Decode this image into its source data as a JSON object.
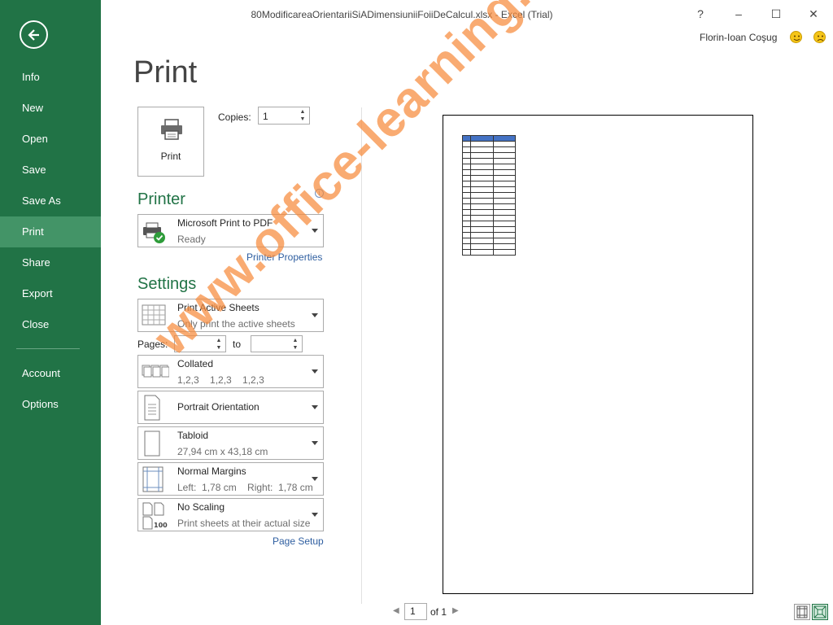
{
  "window": {
    "title": "80ModificareaOrientariiSiADimensiuniiFoiiDeCalcul.xlsx - Excel (Trial)",
    "help": "?",
    "minimize": "–",
    "maximize": "☐",
    "close": "✕",
    "user": "Florin-Ioan Coşug"
  },
  "nav": {
    "items": [
      {
        "label": "Info"
      },
      {
        "label": "New"
      },
      {
        "label": "Open"
      },
      {
        "label": "Save"
      },
      {
        "label": "Save As"
      },
      {
        "label": "Print"
      },
      {
        "label": "Share"
      },
      {
        "label": "Export"
      },
      {
        "label": "Close"
      },
      {
        "label": "Account"
      },
      {
        "label": "Options"
      }
    ],
    "active": "Print"
  },
  "heading": "Print",
  "print_button": "Print",
  "copies": {
    "label": "Copies:",
    "value": "1"
  },
  "printer": {
    "section_title": "Printer",
    "name": "Microsoft Print to PDF",
    "status": "Ready",
    "properties_link": "Printer Properties"
  },
  "settings": {
    "section_title": "Settings",
    "what": {
      "main": "Print Active Sheets",
      "sub": "Only print the active sheets"
    },
    "pages_label": "Pages:",
    "to_label": "to",
    "collation": {
      "main": "Collated",
      "sub": "1,2,3    1,2,3    1,2,3"
    },
    "orientation": {
      "main": "Portrait Orientation"
    },
    "paper": {
      "main": "Tabloid",
      "sub": "27,94 cm x 43,18 cm"
    },
    "margins": {
      "main": "Normal Margins",
      "sub": "Left:  1,78 cm    Right:  1,78 cm"
    },
    "scaling": {
      "main": "No Scaling",
      "sub": "Print sheets at their actual size"
    },
    "scaling_icon_text": "100",
    "page_setup_link": "Page Setup"
  },
  "preview": {
    "watermark": "www.office-learning.ro",
    "page_current": "1",
    "page_total": "of 1"
  },
  "colors": {
    "accent": "#217346",
    "nav_active": "#439467",
    "link": "#2e5ea0"
  }
}
